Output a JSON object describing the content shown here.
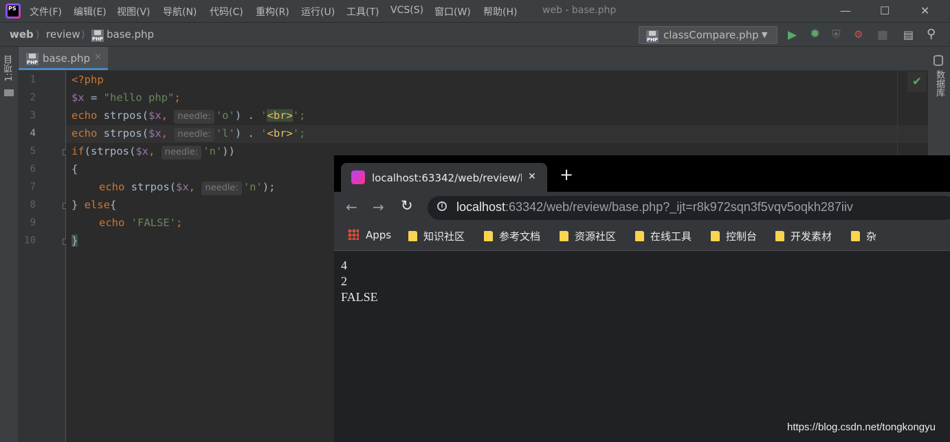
{
  "app": {
    "logo_text": "PS",
    "title": "web - base.php",
    "menu": [
      "文件(F)",
      "编辑(E)",
      "视图(V)",
      "导航(N)",
      "代码(C)",
      "重构(R)",
      "运行(U)",
      "工具(T)",
      "VCS(S)",
      "窗口(W)",
      "帮助(H)"
    ]
  },
  "breadcrumb": [
    "web",
    "review",
    "base.php"
  ],
  "run_config": "classCompare.php",
  "left_tool": "1:项目",
  "right_tool": "数据库",
  "editor_tab": "base.php",
  "code": {
    "line_numbers": [
      "1",
      "2",
      "3",
      "4",
      "5",
      "6",
      "7",
      "8",
      "9",
      "10"
    ],
    "l1": "<?php",
    "l2_var": "$x",
    "l2_eq": " = ",
    "l2_str": "\"hello php\"",
    "l2_end": ";",
    "echo": "echo",
    "strpos": " strpos(",
    "x": "$x",
    "comma": ", ",
    "hint_needle": "needle:",
    "o_str": "'o'",
    "l_str": "'l'",
    "n_str": "'n'",
    "dot": ") . ",
    "q": "'",
    "br": "<br>",
    "q_end": "';",
    "if": "if",
    "if_strpos": "(strpos(",
    "close2": "))",
    "brace_open": "{",
    "close_semi": ");",
    "brace_close": "}",
    "else": " else",
    "false_str": "'FALSE'",
    "semi": ";"
  },
  "browser": {
    "tab_title": "localhost:63342/web/review/b",
    "new_tab": "+",
    "url_host": "localhost",
    "url_rest": ":63342/web/review/base.php?_ijt=r8k972sqn3f5vqv5oqkh287iiv",
    "bookmarks": [
      "Apps",
      "知识社区",
      "参考文档",
      "资源社区",
      "在线工具",
      "控制台",
      "开发素材",
      "杂"
    ],
    "output": [
      "4",
      "2",
      "FALSE"
    ]
  },
  "watermark": "https://blog.csdn.net/tongkongyu",
  "colors": {
    "keyword": "#cc7832",
    "variable": "#9876aa",
    "string": "#6a8759",
    "run_green": "#59a869",
    "tab_accent": "#4a88c7"
  }
}
